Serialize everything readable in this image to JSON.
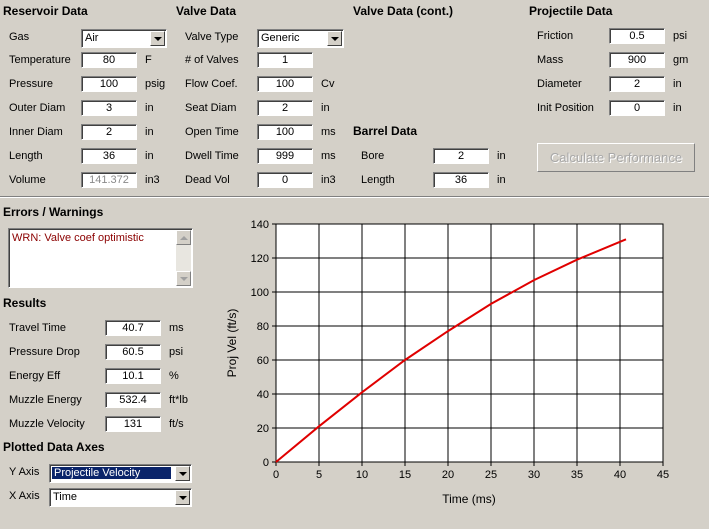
{
  "reservoir": {
    "title": "Reservoir Data",
    "gas_label": "Gas",
    "gas_value": "Air",
    "temperature_label": "Temperature",
    "temperature_value": "80",
    "temperature_unit": "F",
    "pressure_label": "Pressure",
    "pressure_value": "100",
    "pressure_unit": "psig",
    "outer_diam_label": "Outer Diam",
    "outer_diam_value": "3",
    "outer_diam_unit": "in",
    "inner_diam_label": "Inner Diam",
    "inner_diam_value": "2",
    "inner_diam_unit": "in",
    "length_label": "Length",
    "length_value": "36",
    "length_unit": "in",
    "volume_label": "Volume",
    "volume_value": "141.372",
    "volume_unit": "in3"
  },
  "valve": {
    "title": "Valve Data",
    "type_label": "Valve Type",
    "type_value": "Generic",
    "num_label": "# of Valves",
    "num_value": "1",
    "flow_label": "Flow Coef.",
    "flow_value": "100",
    "flow_unit": "Cv",
    "seat_label": "Seat Diam",
    "seat_value": "2",
    "seat_unit": "in",
    "open_label": "Open Time",
    "open_value": "100",
    "open_unit": "ms",
    "dwell_label": "Dwell Time",
    "dwell_value": "999",
    "dwell_unit": "ms",
    "dead_label": "Dead Vol",
    "dead_value": "0",
    "dead_unit": "in3"
  },
  "valve_cont": {
    "title": "Valve Data (cont.)"
  },
  "barrel": {
    "title": "Barrel Data",
    "bore_label": "Bore",
    "bore_value": "2",
    "bore_unit": "in",
    "length_label": "Length",
    "length_value": "36",
    "length_unit": "in"
  },
  "projectile": {
    "title": "Projectile Data",
    "friction_label": "Friction",
    "friction_value": "0.5",
    "friction_unit": "psi",
    "mass_label": "Mass",
    "mass_value": "900",
    "mass_unit": "gm",
    "diameter_label": "Diameter",
    "diameter_value": "2",
    "diameter_unit": "in",
    "init_label": "Init Position",
    "init_value": "0",
    "init_unit": "in"
  },
  "calculate_label": "Calculate Performance",
  "errors": {
    "title": "Errors / Warnings",
    "text": "WRN: Valve coef optimistic"
  },
  "results": {
    "title": "Results",
    "travel_label": "Travel Time",
    "travel_value": "40.7",
    "travel_unit": "ms",
    "pdrop_label": "Pressure Drop",
    "pdrop_value": "60.5",
    "pdrop_unit": "psi",
    "eff_label": "Energy Eff",
    "eff_value": "10.1",
    "eff_unit": "%",
    "energy_label": "Muzzle Energy",
    "energy_value": "532.4",
    "energy_unit": "ft*lb",
    "velocity_label": "Muzzle Velocity",
    "velocity_value": "131",
    "velocity_unit": "ft/s"
  },
  "axes": {
    "title": "Plotted Data Axes",
    "y_label": "Y Axis",
    "y_value": "Projectile Velocity",
    "x_label": "X Axis",
    "x_value": "Time"
  },
  "colors": {
    "window": "#d4d0c8",
    "series": "#e00000",
    "selection": "#0a246a",
    "warning_text": "#8b0000"
  },
  "chart_data": {
    "type": "line",
    "xlabel": "Time (ms)",
    "ylabel": "Proj Vel (ft/s)",
    "xlim": [
      0,
      45
    ],
    "ylim": [
      0,
      140
    ],
    "xticks": [
      "0",
      "5",
      "10",
      "15",
      "20",
      "25",
      "30",
      "35",
      "40",
      "45"
    ],
    "yticks": [
      "0",
      "20",
      "40",
      "60",
      "80",
      "100",
      "120",
      "140"
    ],
    "grid": true,
    "series": [
      {
        "x": [
          0,
          5,
          10,
          15,
          20,
          25,
          30,
          35,
          40.7
        ],
        "y": [
          0,
          21,
          41,
          60,
          77,
          93,
          107,
          119,
          131
        ]
      }
    ]
  }
}
